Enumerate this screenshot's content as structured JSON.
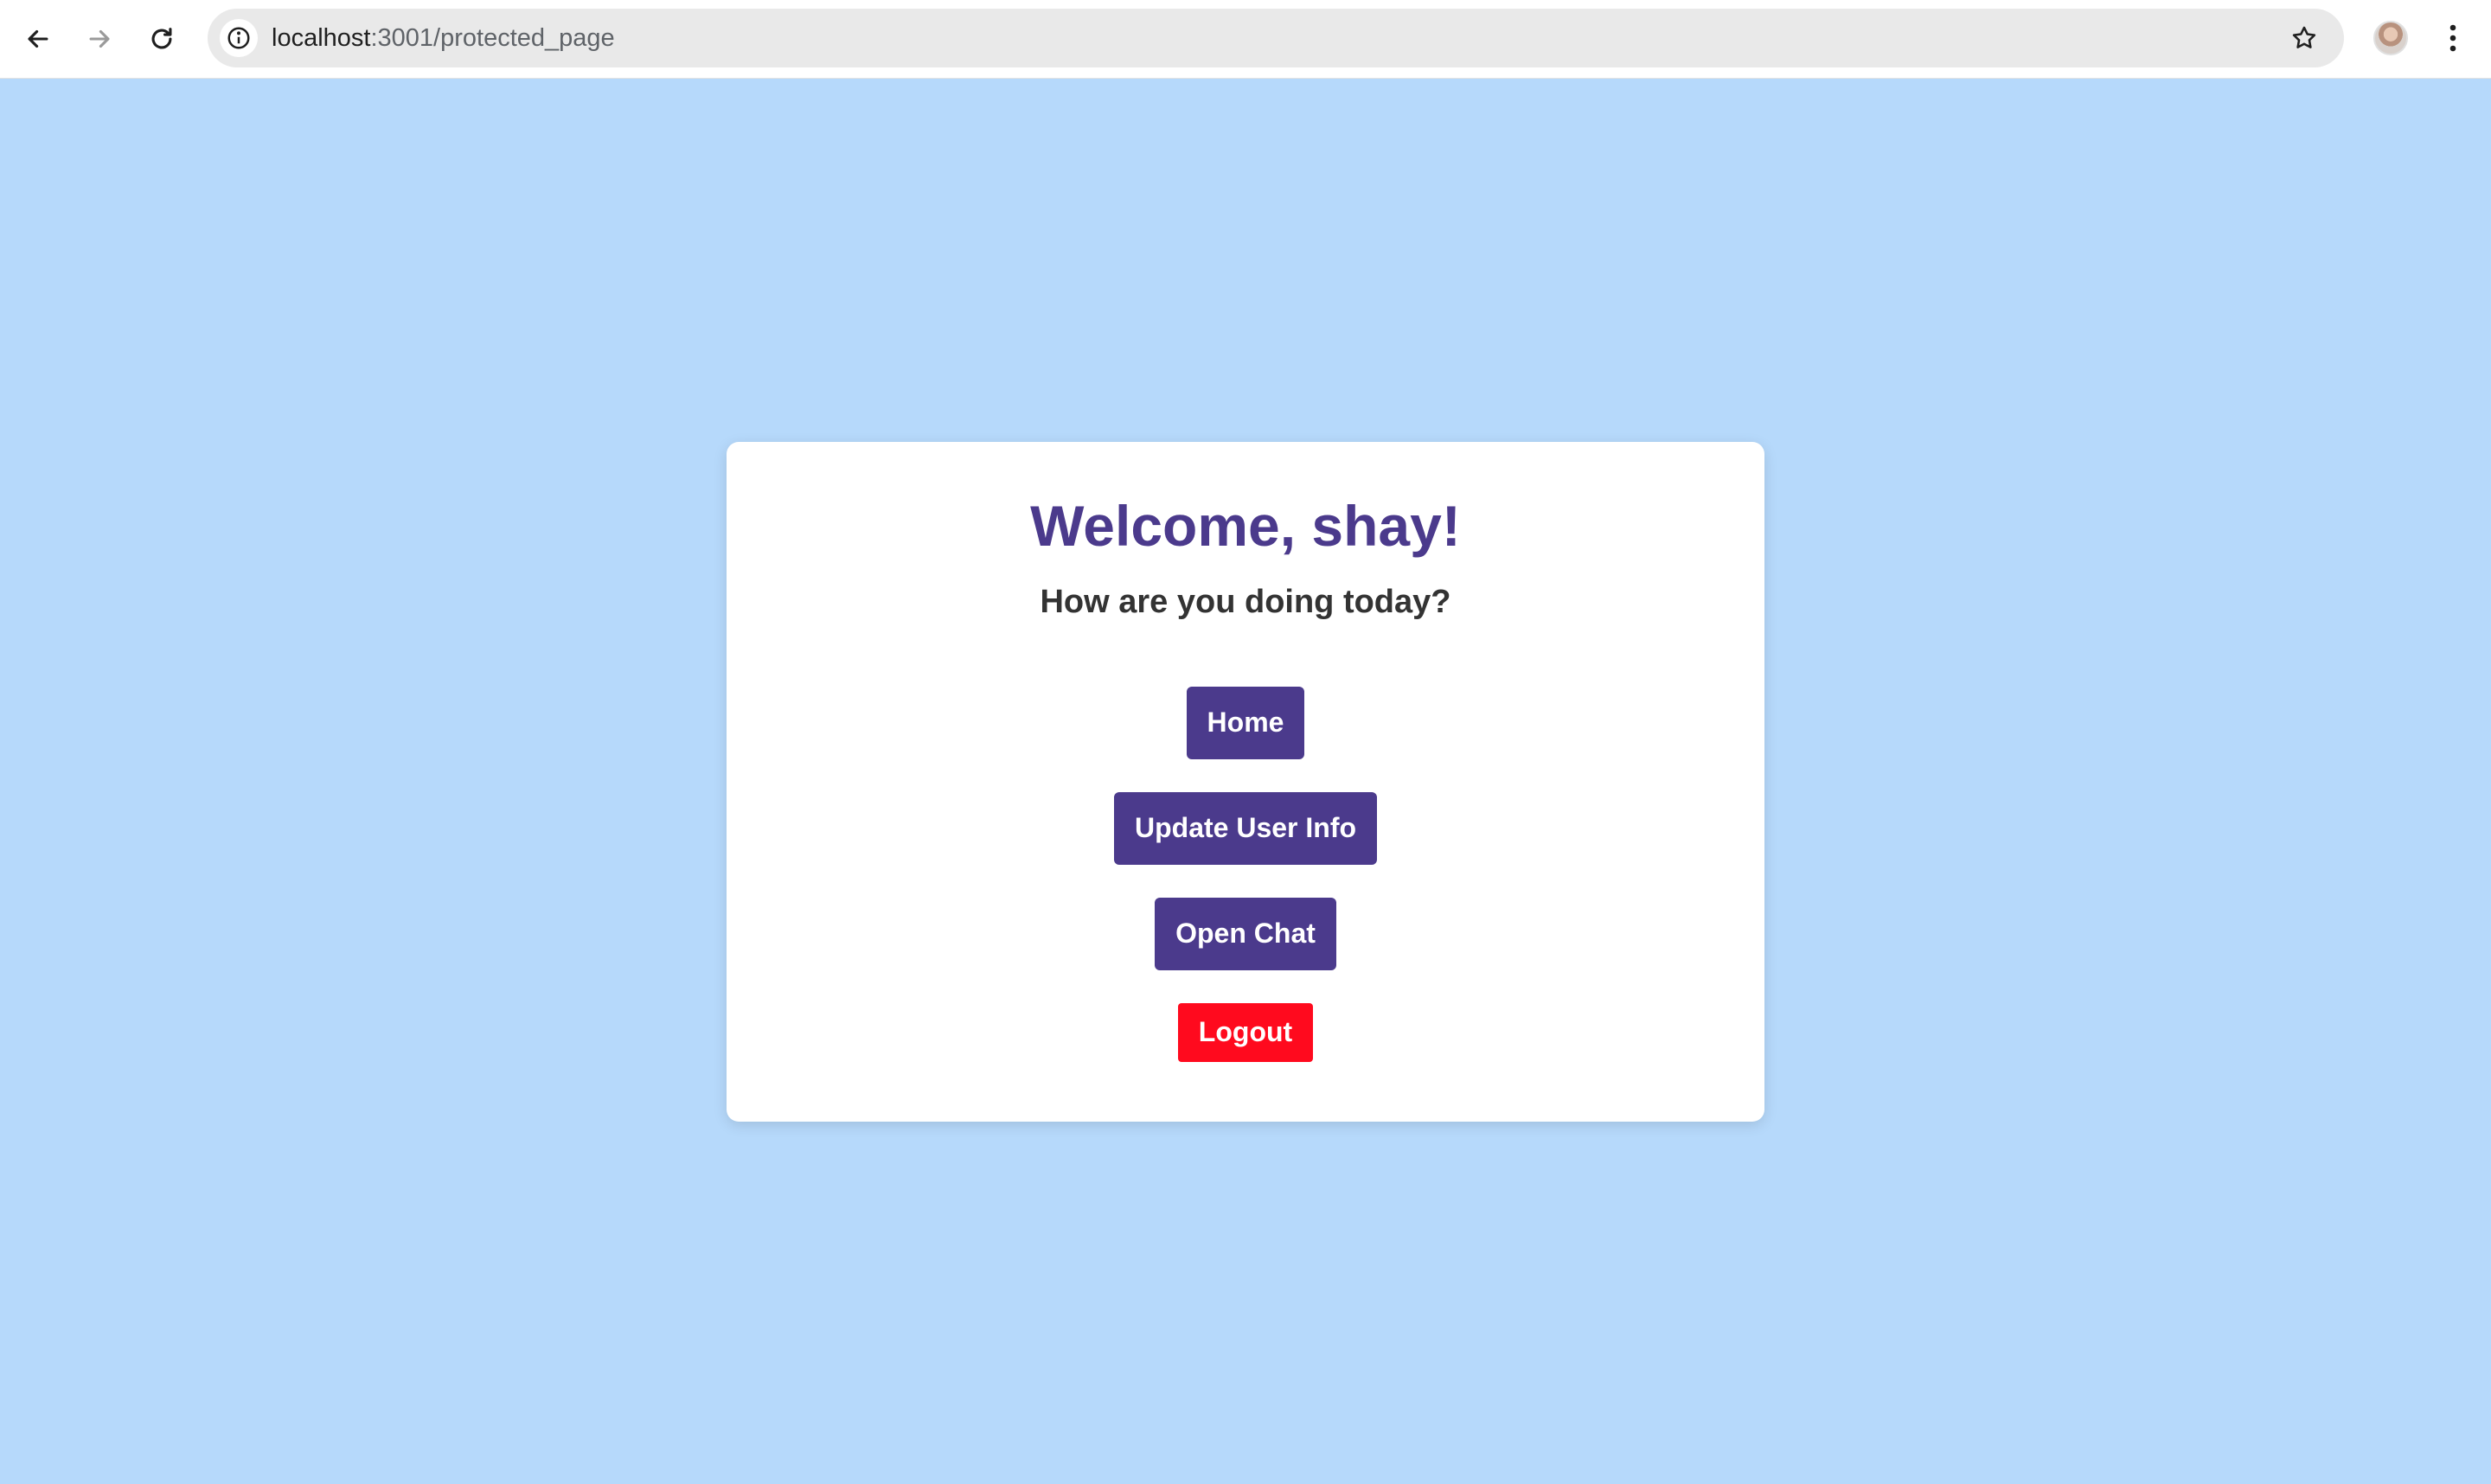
{
  "browser": {
    "url_host": "localhost",
    "url_path": ":3001/protected_page"
  },
  "card": {
    "title": "Welcome, shay!",
    "subtitle": "How are you doing today?",
    "buttons": {
      "home": "Home",
      "update_user_info": "Update User Info",
      "open_chat": "Open Chat",
      "logout": "Logout"
    }
  },
  "icons": [
    "back-arrow-icon",
    "forward-arrow-icon",
    "reload-icon",
    "site-info-icon",
    "bookmark-star-icon",
    "kebab-menu-icon"
  ],
  "colors": {
    "page_background": "#b6d9fb",
    "primary": "#4b3a8c",
    "danger": "#ff0a1e",
    "card": "#ffffff"
  }
}
